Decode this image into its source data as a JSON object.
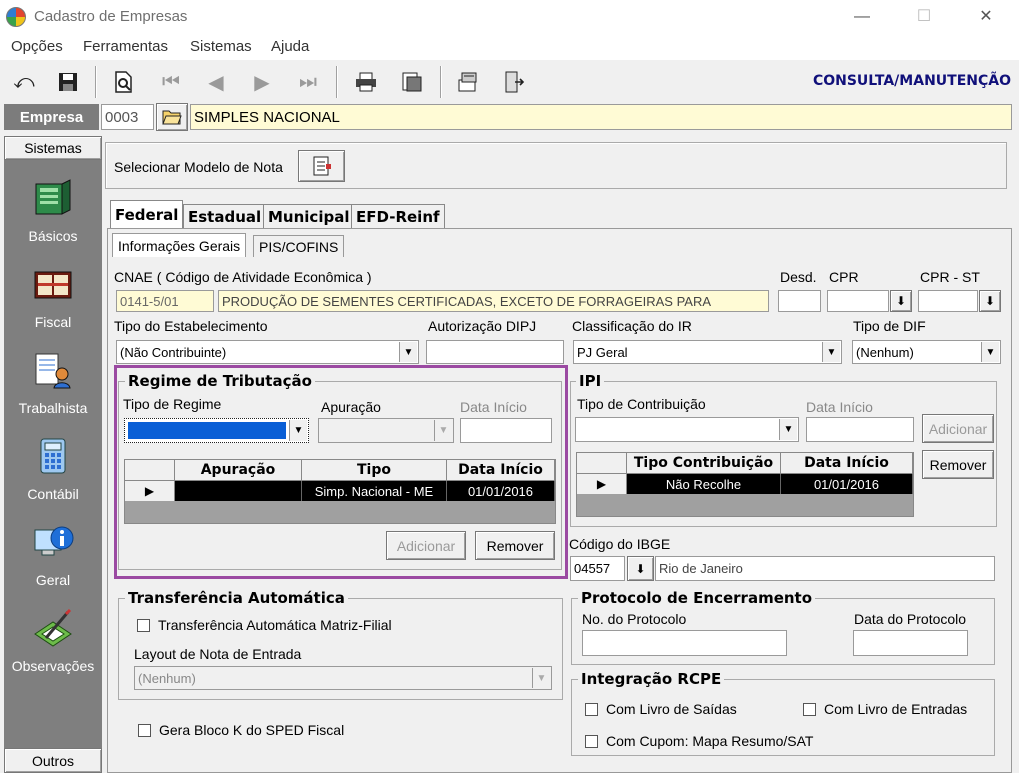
{
  "window": {
    "title": "Cadastro de Empresas",
    "minimize": "—",
    "maximize": "☐",
    "close": "✕"
  },
  "menu": [
    "Opções",
    "Ferramentas",
    "Sistemas",
    "Ajuda"
  ],
  "toolbar": {
    "mode_label": "CONSULTA/MANUTENÇÃO"
  },
  "empresa": {
    "label": "Empresa",
    "code": "0003",
    "name": "SIMPLES NACIONAL"
  },
  "sidebar": {
    "header": "Sistemas",
    "footer": "Outros",
    "items": [
      {
        "label": "Básicos",
        "icon": "book-icon"
      },
      {
        "label": "Fiscal",
        "icon": "ledger-icon"
      },
      {
        "label": "Trabalhista",
        "icon": "worker-icon"
      },
      {
        "label": "Contábil",
        "icon": "calculator-icon"
      },
      {
        "label": "Geral",
        "icon": "info-computer-icon"
      },
      {
        "label": "Observações",
        "icon": "pen-note-icon"
      }
    ]
  },
  "modelo": {
    "label": "Selecionar Modelo de Nota"
  },
  "tabs": [
    "Federal",
    "Estadual",
    "Municipal",
    "EFD-Reinf"
  ],
  "subtabs": [
    "Informações Gerais",
    "PIS/COFINS"
  ],
  "cnae": {
    "label": "CNAE ( Código de  Atividade Econômica )",
    "code": "0141-5/01",
    "description": "PRODUÇÃO DE SEMENTES CERTIFICADAS, EXCETO DE FORRAGEIRAS PARA",
    "desd_label": "Desd.",
    "cpr_label": "CPR",
    "cprst_label": "CPR - ST"
  },
  "tipo_estab": {
    "label": "Tipo do Estabelecimento",
    "value": "(Não Contribuinte)"
  },
  "autorizacao": {
    "label": "Autorização DIPJ"
  },
  "classificacao": {
    "label": "Classificação do IR",
    "value": "PJ Geral"
  },
  "tipo_dif": {
    "label": "Tipo de DIF",
    "value": "(Nenhum)"
  },
  "regime": {
    "title": "Regime de Tributação",
    "tipo_label": "Tipo de Regime",
    "apuracao_label": "Apuração",
    "data_inicio_label": "Data Início",
    "grid_headers": [
      "Apuração",
      "Tipo",
      "Data Início"
    ],
    "rows": [
      {
        "apuracao": "",
        "tipo": "Simp. Nacional - ME",
        "data_inicio": "01/01/2016"
      }
    ],
    "adicionar": "Adicionar",
    "remover": "Remover"
  },
  "ipi": {
    "title": "IPI",
    "tipo_label": "Tipo de Contribuição",
    "data_inicio_label": "Data Início",
    "adicionar": "Adicionar",
    "remover": "Remover",
    "grid_headers": [
      "Tipo Contribuição",
      "Data Início"
    ],
    "rows": [
      {
        "tipo": "Não Recolhe",
        "data_inicio": "01/01/2016"
      }
    ]
  },
  "ibge": {
    "label": "Código do IBGE",
    "code": "04557",
    "city": "Rio de Janeiro"
  },
  "transferencia": {
    "title": "Transferência Automática",
    "checkbox_label": "Transferência Automática Matriz-Filial",
    "layout_label": "Layout de Nota de Entrada",
    "layout_value": "(Nenhum)"
  },
  "protocolo": {
    "title": "Protocolo de Encerramento",
    "numero_label": "No. do Protocolo",
    "data_label": "Data do Protocolo"
  },
  "rcpe": {
    "title": "Integração RCPE",
    "saidas": "Com Livro de Saídas",
    "entradas": "Com Livro de Entradas",
    "cupom": "Com Cupom: Mapa Resumo/SAT"
  },
  "bloco_k": {
    "label": "Gera Bloco K do SPED Fiscal"
  },
  "colors": {
    "highlight": "#9b4aa2",
    "mode_label": "#10107a",
    "sidebar": "#7f7f7f",
    "input_yellow": "#fffbd5"
  }
}
